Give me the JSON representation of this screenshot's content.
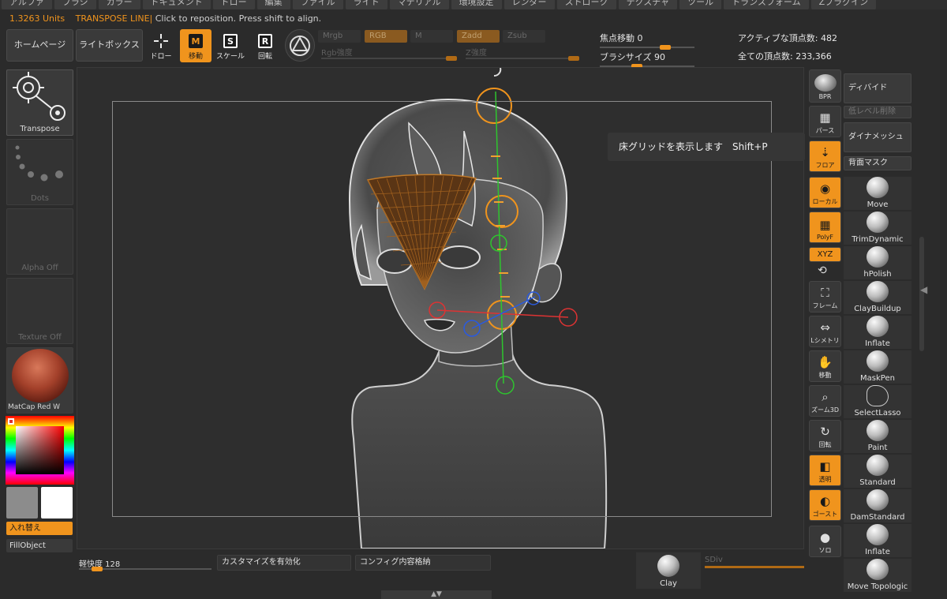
{
  "menu": {
    "items": [
      "アルファ",
      "ブラシ",
      "カラー",
      "ドキュメント",
      "ドロー",
      "編集",
      "ファイル",
      "ライト",
      "マテリアル",
      "環境設定",
      "レンダー",
      "ストローク",
      "テクスチャ",
      "ツール",
      "トランスフォーム",
      "Zプラグイン"
    ]
  },
  "status": {
    "units": "1.3263 Units",
    "message": "TRANSPOSE LINE|",
    "hint": "Click to reposition. Press shift to align."
  },
  "toolbar": {
    "home": "ホームページ",
    "lightbox": "ライトボックス",
    "draw": "ドロー",
    "move": "移動",
    "scale": "スケール",
    "rotate": "回転",
    "move_glyph": "M",
    "scale_glyph": "S",
    "rotate_glyph": "R",
    "mrgb": "Mrgb",
    "rgb": "RGB",
    "m": "M",
    "zadd": "Zadd",
    "zsub": "Zsub",
    "rgb_intensity": "Rgb強度",
    "z_intensity": "Z強度",
    "focal_shift": "焦点移動 0",
    "draw_size": "ブラシサイズ 90",
    "active_points": "アクティブな頂点数: 482",
    "total_points": "全ての頂点数: 233,366"
  },
  "left": {
    "transpose": "Transpose",
    "dots": "Dots",
    "alpha": "Alpha Off",
    "texture": "Texture Off",
    "material": "MatCap Red W",
    "swap": "入れ替え",
    "fill_object": "FillObject"
  },
  "canvas": {
    "tooltip": "床グリッドを表示します",
    "shortcut": "Shift+P"
  },
  "right": {
    "icons": [
      "BPR",
      "パース",
      "フロア",
      "ローカル",
      "PolyF",
      "XYZ",
      "",
      "フレーム",
      "Lシメトリ",
      "移動",
      "ズーム3D",
      "回転",
      "透明",
      "ゴースト",
      "ソロ"
    ],
    "divide": "ディバイド",
    "del_lower": "低レベル削除",
    "dynamesh": "ダイナメッシュ",
    "back_mask": "背面マスク",
    "brushes": [
      "Move",
      "TrimDynamic",
      "hPolish",
      "ClayBuildup",
      "Inflate",
      "MaskPen",
      "SelectLasso",
      "Paint",
      "Standard",
      "DamStandard",
      "Inflate",
      "Move Topologic"
    ]
  },
  "bottom": {
    "lazy": "軽快度 128",
    "customize": "カスタマイズを有効化",
    "store_config": "コンフィグ内容格納",
    "clay": "Clay",
    "sdiv": "SDiv"
  },
  "colors": {
    "accent": "#f0941d",
    "bg": "#2b2b2b"
  }
}
